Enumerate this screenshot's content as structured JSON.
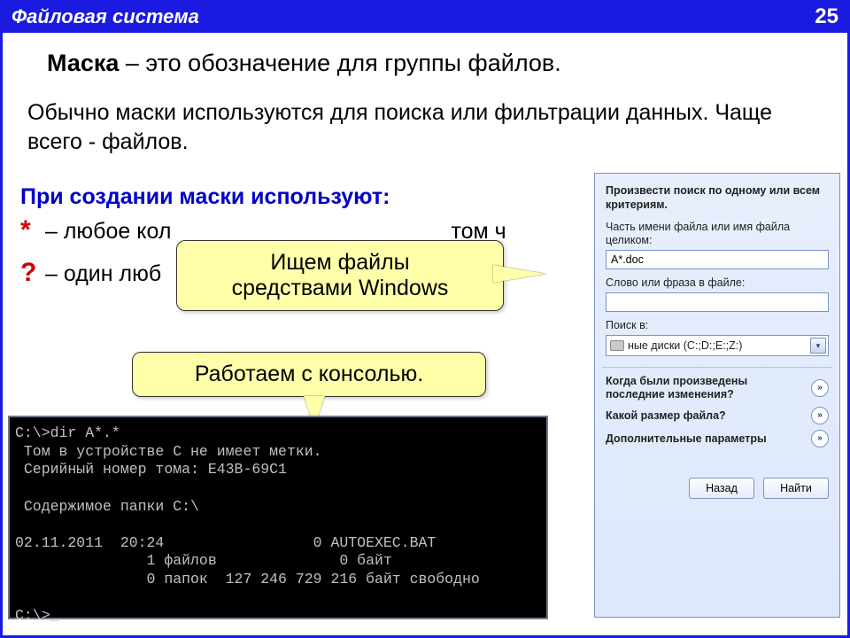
{
  "header": {
    "title": "Файловая система",
    "page": "25"
  },
  "intro": {
    "bold": "Маска",
    "rest": " – это обозначение для группы файлов."
  },
  "para2": "Обычно маски используются для поиска или фильтрации данных. Чаще всего - файлов.",
  "para3": "При создании маски используют:",
  "bullets": [
    {
      "sym": "*",
      "text_start": "– любое кол",
      "text_end": "том ч"
    },
    {
      "sym": "?",
      "text_start": "– один люб",
      "text_end": ""
    }
  ],
  "callout1": {
    "line1": "Ищем файлы",
    "line2": "средствами Windows"
  },
  "callout2": "Работаем с консолью.",
  "console_lines": "C:\\>dir A*.*\n Том в устройстве C не имеет метки.\n Серийный номер тома: E43B-69C1\n\n Содержимое папки C:\\\n\n02.11.2011  20:24                 0 AUTOEXEC.BAT\n               1 файлов              0 байт\n               0 папок  127 246 729 216 байт свободно\n\nC:\\>_",
  "search": {
    "header": "Произвести поиск по одному или всем критериям.",
    "lbl_partname": "Часть имени файла или имя файла целиком:",
    "val_partname": "A*.doc",
    "lbl_phrase": "Слово или фраза в файле:",
    "val_phrase": "",
    "lbl_lookin": "Поиск в:",
    "combo_text": "ные диски (C:;D:;E:;Z:)",
    "q1": "Когда были произведены последние изменения?",
    "q2": "Какой размер файла?",
    "q3": "Дополнительные параметры",
    "btn_back": "Назад",
    "btn_find": "Найти",
    "chevron": "»"
  }
}
